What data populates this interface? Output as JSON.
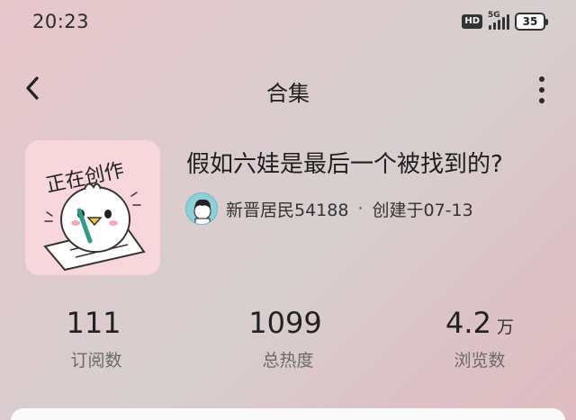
{
  "status_bar": {
    "time": "20:23",
    "hd_label": "HD",
    "network_label": "5G",
    "battery_level": "35"
  },
  "nav": {
    "title": "合集"
  },
  "album": {
    "cover_text": "正在创作",
    "title": "假如六娃是最后一个被找到的?",
    "author": "新晋居民54188",
    "separator": "·",
    "created": "创建于07-13"
  },
  "stats": [
    {
      "value": "111",
      "unit": "",
      "label": "订阅数"
    },
    {
      "value": "1099",
      "unit": "",
      "label": "总热度"
    },
    {
      "value": "4.2",
      "unit": "万",
      "label": "浏览数"
    }
  ]
}
